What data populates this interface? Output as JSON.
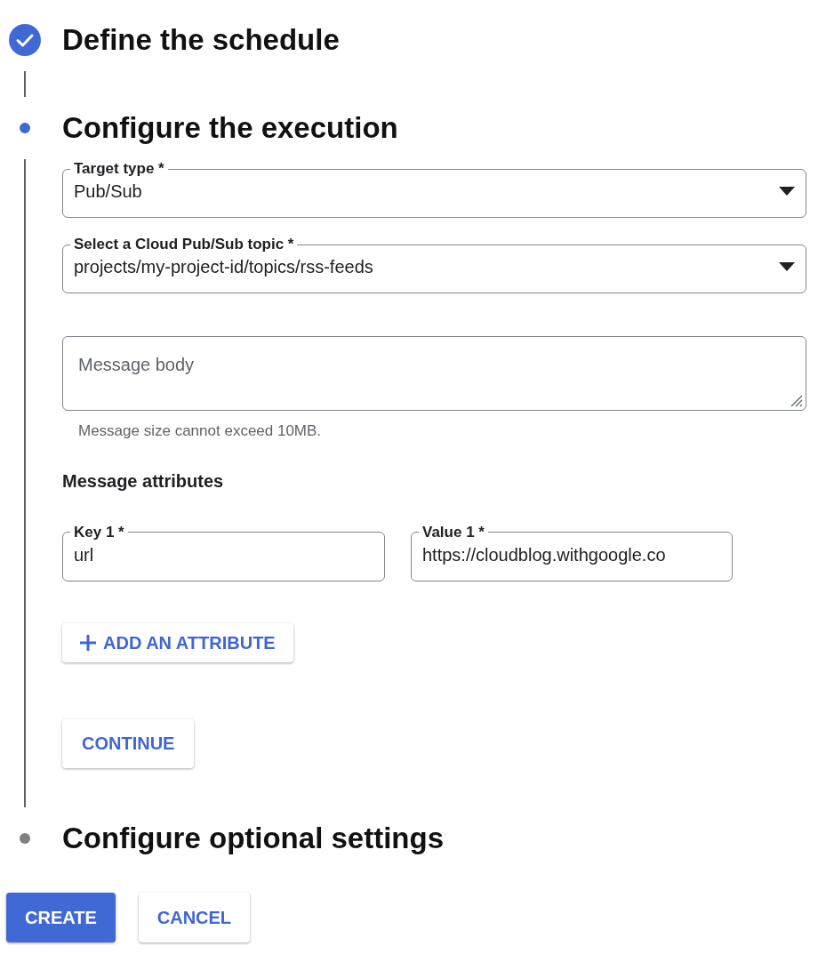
{
  "steps": [
    {
      "title": "Define the schedule",
      "kind": "done"
    },
    {
      "title": "Configure the execution",
      "kind": "active"
    },
    {
      "title": "Configure optional settings",
      "kind": "pending"
    }
  ],
  "execution": {
    "target_type": {
      "label": "Target type *",
      "value": "Pub/Sub"
    },
    "topic": {
      "label": "Select a Cloud Pub/Sub topic *",
      "value": "projects/my-project-id/topics/rss-feeds"
    },
    "message_body": {
      "placeholder": "Message body",
      "hint": "Message size cannot exceed 10MB."
    },
    "attributes_heading": "Message attributes",
    "attributes": [
      {
        "key_label": "Key 1 *",
        "key": "url",
        "value_label": "Value 1 *",
        "value": "https://cloudblog.withgoogle.co"
      }
    ],
    "add_attribute_button": "ADD AN ATTRIBUTE",
    "continue_button": "CONTINUE"
  },
  "actions": {
    "create_button": "CREATE",
    "cancel_button": "CANCEL"
  }
}
